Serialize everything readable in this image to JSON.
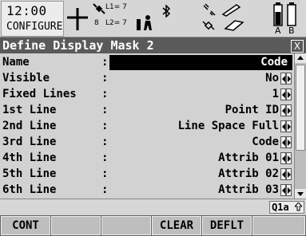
{
  "status": {
    "time": "12:00",
    "mode": "CONFIGURE",
    "l1_count": "L1= 7",
    "l2_count": "L2= 7",
    "l2_prefix": "8",
    "keyboard_indicator": "Q1a",
    "battery_labels": [
      "A",
      "B"
    ]
  },
  "window": {
    "title": "Define Display Mask 2",
    "close_symbol": "X"
  },
  "fields": [
    {
      "label": "Name",
      "value": "Code",
      "type": "input"
    },
    {
      "label": "Visible",
      "value": "No",
      "type": "choice"
    },
    {
      "label": "Fixed Lines",
      "value": "1",
      "type": "choice"
    },
    {
      "label": "1st Line",
      "value": "Point ID",
      "type": "choice"
    },
    {
      "label": "2nd Line",
      "value": "Line Space Full",
      "type": "choice"
    },
    {
      "label": "3rd Line",
      "value": "Code",
      "type": "choice"
    },
    {
      "label": "4th Line",
      "value": "Attrib 01",
      "type": "choice"
    },
    {
      "label": "5th Line",
      "value": "Attrib 02",
      "type": "choice"
    },
    {
      "label": "6th Line",
      "value": "Attrib 03",
      "type": "choice"
    }
  ],
  "softkeys": [
    "CONT",
    "",
    "",
    "CLEAR",
    "DEFLT",
    ""
  ],
  "colors": {
    "title_bg": "#5a5a5a",
    "content_bg": "#d2d2d2",
    "fkey_bg": "#bebebe"
  }
}
